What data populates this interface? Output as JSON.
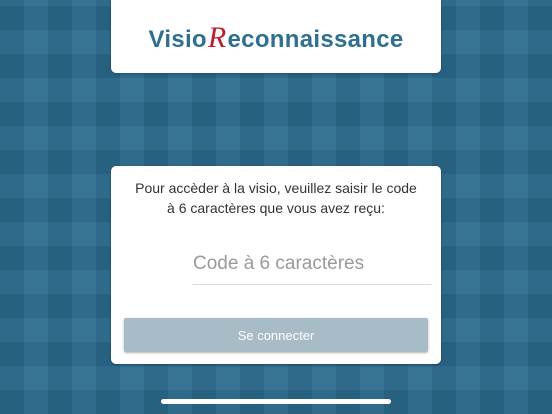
{
  "logo": {
    "part1": "Visio",
    "accent_letter": "R",
    "part2": "econnaissance",
    "primary_color": "#2f6f8f",
    "accent_color": "#c01b2a"
  },
  "login": {
    "prompt_line1": "Pour accèder à la visio, veuillez saisir le code",
    "prompt_line2": "à 6 caractères que vous avez reçu:",
    "code_input": {
      "value": "",
      "placeholder": "Code à 6 caractères"
    },
    "connect_label": "Se connecter"
  },
  "colors": {
    "background": "#2c6b8e",
    "button_disabled": "#a7bcc7"
  }
}
